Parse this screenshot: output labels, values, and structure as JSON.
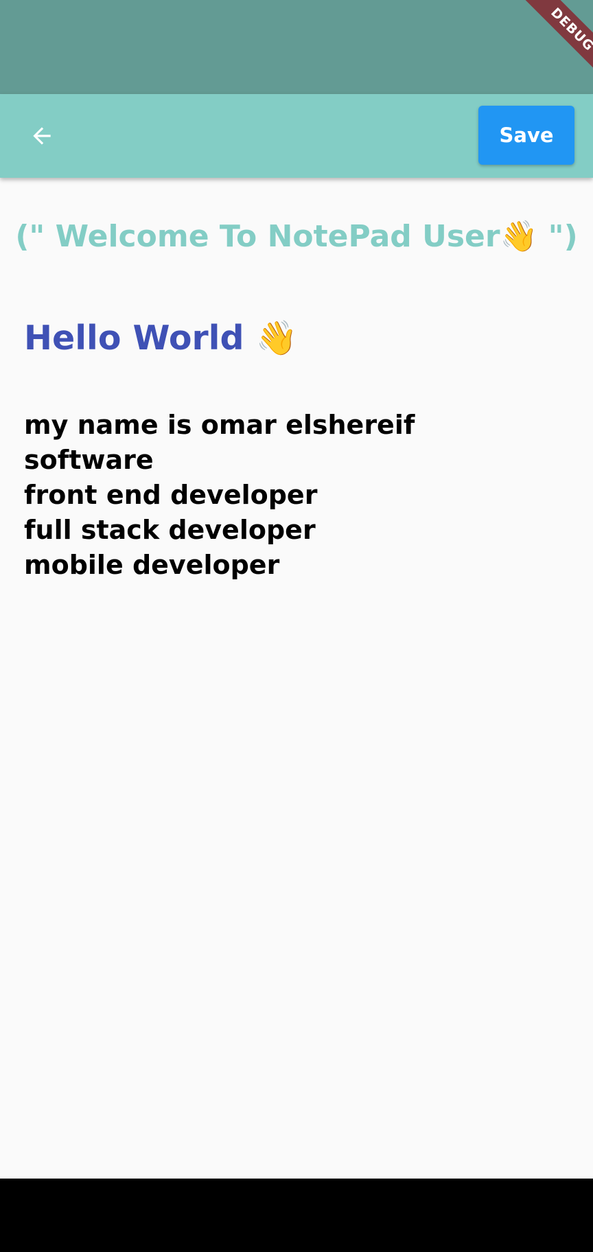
{
  "app_bar": {
    "back_icon": "arrow-back-icon",
    "save_label": "Save",
    "background_color": "#83cdc5",
    "save_color": "#2196f3"
  },
  "status_bar": {
    "background_color": "#639b94"
  },
  "debug_banner": "DEBUG",
  "welcome_text": "(\" Welcome To NotePad User👋 \")",
  "note": {
    "title": "Hello World 👋",
    "body_lines": [
      "my name is omar elshereif",
      "software",
      "front end developer",
      "full stack developer",
      "mobile developer"
    ]
  },
  "colors": {
    "welcome": "#83cdc5",
    "title": "#3f51b5",
    "body": "#000000"
  }
}
